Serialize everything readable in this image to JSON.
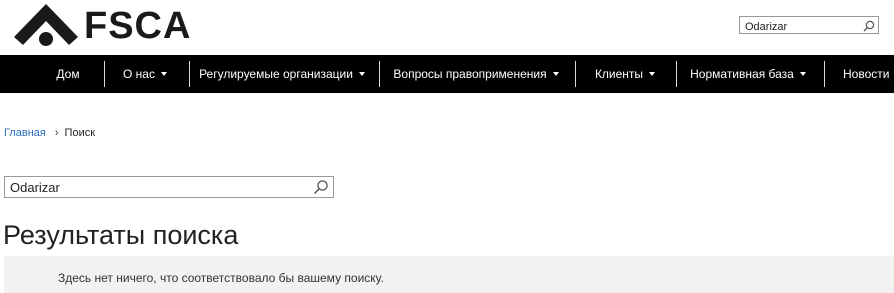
{
  "brand": {
    "name": "FSCA"
  },
  "header_search": {
    "value": "Odarizar",
    "icon": "search-icon"
  },
  "nav": {
    "items": [
      {
        "label": "Дом",
        "dropdown": false
      },
      {
        "label": "О нас",
        "dropdown": true
      },
      {
        "label": "Регулируемые организации",
        "dropdown": true
      },
      {
        "label": "Вопросы правоприменения",
        "dropdown": true
      },
      {
        "label": "Клиенты",
        "dropdown": true
      },
      {
        "label": "Нормативная база",
        "dropdown": true
      },
      {
        "label": "Новости",
        "dropdown": false
      }
    ]
  },
  "breadcrumb": {
    "home": "Главная",
    "current": "Поиск"
  },
  "search": {
    "value": "Odarizar",
    "icon": "search-icon"
  },
  "results": {
    "title": "Результаты поиска",
    "empty_message": "Здесь нет ничего, что соответствовало бы вашему поиску."
  },
  "colors": {
    "nav_bg": "#000000",
    "link": "#2a6ebb",
    "results_bg": "#f2f2f2"
  }
}
